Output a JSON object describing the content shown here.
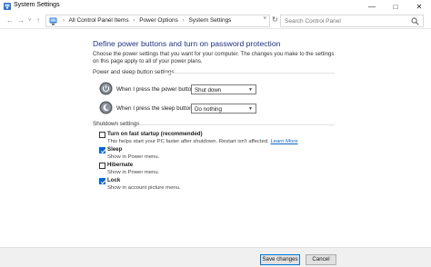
{
  "window": {
    "title": "System Settings",
    "minimize_glyph": "—",
    "maximize_glyph": "□",
    "close_glyph": "✕"
  },
  "address_bar": {
    "back_glyph": "←",
    "forward_glyph": "→",
    "recent_glyph": "˅",
    "up_glyph": "↑",
    "crumbs": [
      "All Control Panel Items",
      "Power Options",
      "System Settings"
    ],
    "crumb_separator": "›",
    "dropdown_glyph": "˅",
    "refresh_glyph": "↻"
  },
  "search": {
    "placeholder": "Search Control Panel"
  },
  "main": {
    "heading": "Define power buttons and turn on password protection",
    "description": "Choose the power settings that you want for your computer. The changes you make to the settings on this page apply to all of your power plans.",
    "power_section": {
      "title": "Power and sleep button settings",
      "power_button": {
        "label": "When I press the power button:",
        "value": "Shut down"
      },
      "sleep_button": {
        "label": "When I press the sleep button:",
        "value": "Do nothing"
      }
    },
    "shutdown_section": {
      "title": "Shutdown settings",
      "options": [
        {
          "label": "Turn on fast startup (recommended)",
          "desc": "This helps start your PC faster after shutdown. Restart isn't affected.",
          "link": "Learn More",
          "checked": false
        },
        {
          "label": "Sleep",
          "desc": "Show in Power menu.",
          "checked": true
        },
        {
          "label": "Hibernate",
          "desc": "Show in Power menu.",
          "checked": false
        },
        {
          "label": "Lock",
          "desc": "Show in account picture menu.",
          "checked": true
        }
      ]
    }
  },
  "footer": {
    "save_label": "Save changes",
    "cancel_label": "Cancel"
  },
  "colors": {
    "accent": "#0a64d6",
    "heading": "#1e3287",
    "link": "#0b63c5"
  }
}
